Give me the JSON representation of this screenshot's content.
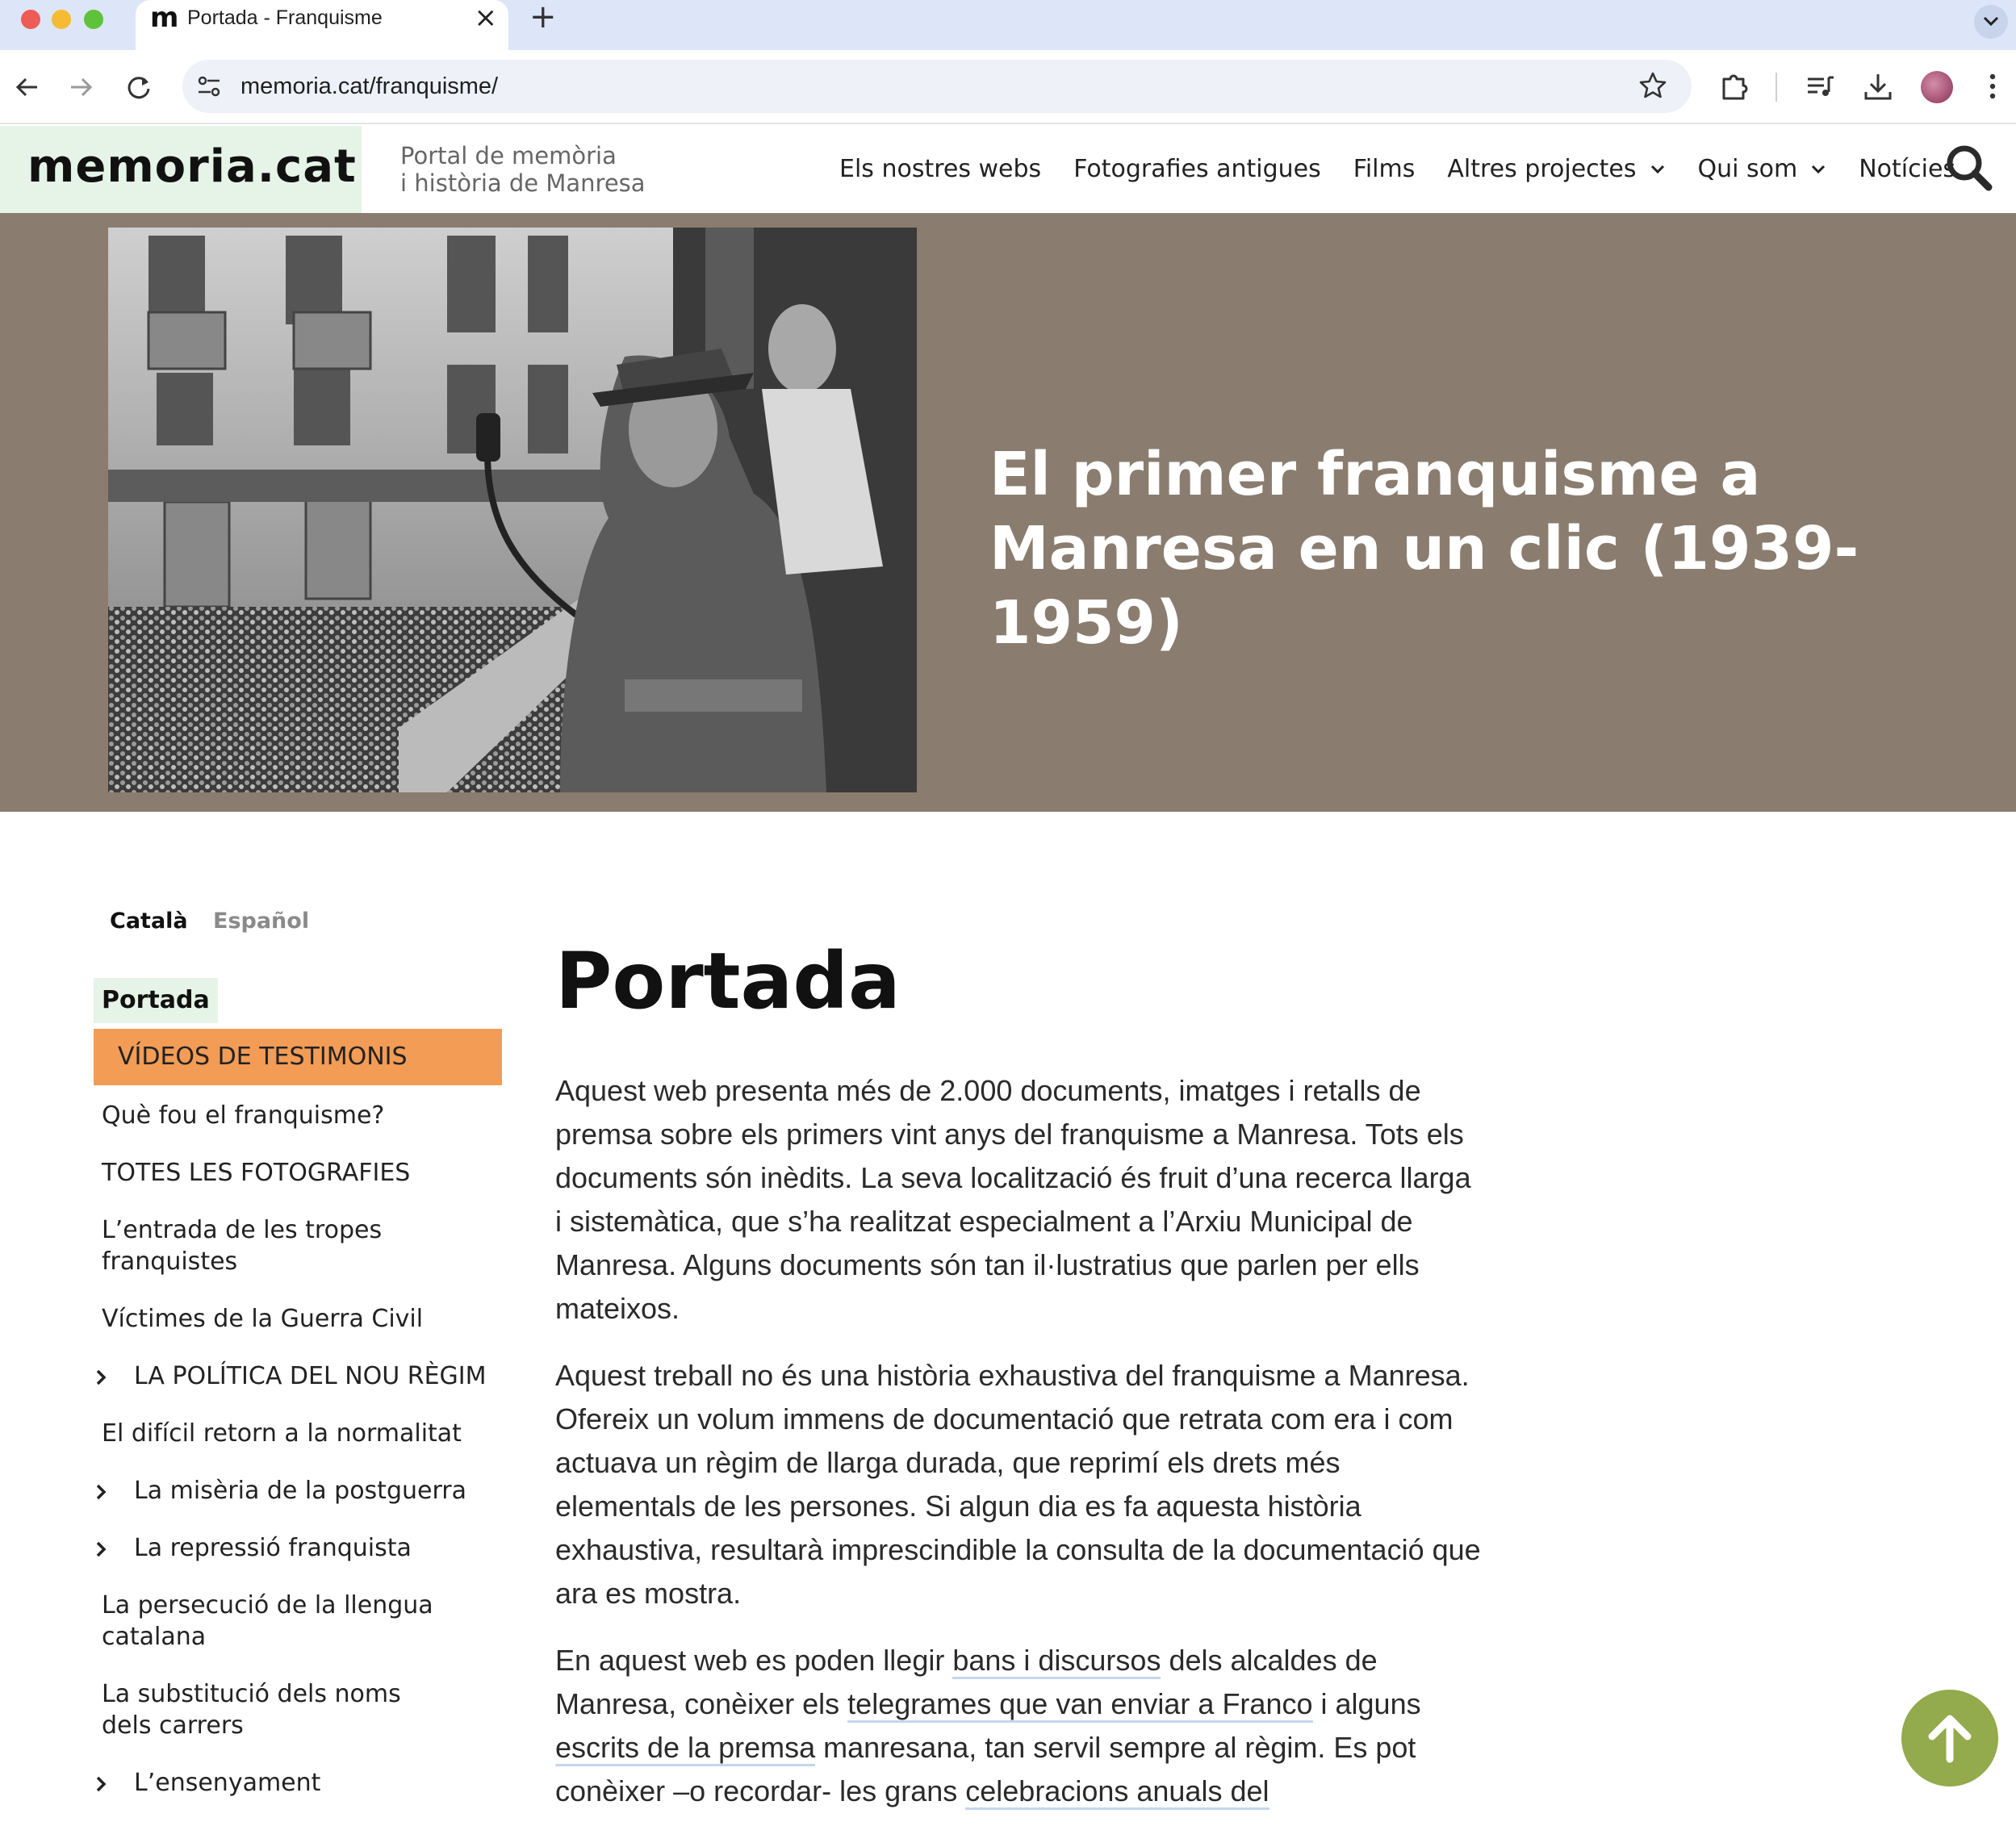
{
  "browser": {
    "tab_title": "Portada - Franquisme",
    "tab_favicon": "m",
    "url": "memoria.cat/franquisme/"
  },
  "site": {
    "logo": "memoria.cat",
    "tagline_line1": "Portal de memòria",
    "tagline_line2": "i història de Manresa",
    "nav": [
      {
        "label": "Els nostres webs"
      },
      {
        "label": "Fotografies antigues"
      },
      {
        "label": "Films"
      },
      {
        "label": "Altres projectes"
      },
      {
        "label": "Qui som"
      },
      {
        "label": "Notícies"
      }
    ]
  },
  "hero": {
    "title": "El primer franquisme a Manresa en un clic (1939-1959)"
  },
  "sidebar": {
    "languages": [
      "Català",
      "Español"
    ],
    "active": "Portada",
    "videos": "VÍDEOS DE TESTIMONIS",
    "items": [
      {
        "label": "Què fou el franquisme?"
      },
      {
        "label": "TOTES LES FOTOGRAFIES"
      },
      {
        "label": "L’entrada de les tropes franquistes"
      },
      {
        "label": "Víctimes de la Guerra Civil"
      },
      {
        "label": "LA POLÍTICA DEL NOU RÈGIM"
      },
      {
        "label": "El difícil retorn a la normalitat"
      },
      {
        "label": "La misèria de la postguerra"
      },
      {
        "label": "La repressió franquista"
      },
      {
        "label": "La persecució de la llengua catalana"
      },
      {
        "label": "La substitució dels noms dels carrers"
      },
      {
        "label": "L’ensenyament"
      }
    ]
  },
  "main": {
    "title": "Portada",
    "p1": "Aquest web presenta més de 2.000 documents, imatges i retalls de premsa sobre els primers vint anys del franquisme a Manresa. Tots els documents són inèdits. La seva localització és fruit d’una recerca llarga i sistemàtica, que s’ha realitzat especialment a l’Arxiu Municipal de Manresa. Alguns documents són tan il·lustratius que parlen per ells mateixos.",
    "p2": "Aquest treball no és una història exhaustiva del franquisme a Manresa. Ofereix un volum immens de documentació que retrata com era i com actuava un règim de llarga durada, que reprimí els drets més elementals de les persones. Si algun dia es fa aquesta història exhaustiva, resultarà imprescindible la consulta de la documentació que ara es mostra.",
    "p3": {
      "t1": "En aquest web es poden llegir ",
      "link1": "bans i discursos",
      "t2": " dels alcaldes de Manresa, conèixer els ",
      "link2": "telegrames que van enviar a Franco",
      "t3": " i alguns ",
      "link3": "escrits de la premsa",
      "t4": " manresana, tan servil sempre al règim. Es pot conèixer –o recordar- les grans ",
      "link4": "celebracions anuals del"
    }
  },
  "colors": {
    "logo_bg": "#e6f4e7",
    "hero_bg": "#8a7d6f",
    "videos_bg": "#f29c55",
    "to_top": "#93aa4d",
    "link_underline": "#c4d6ec"
  }
}
